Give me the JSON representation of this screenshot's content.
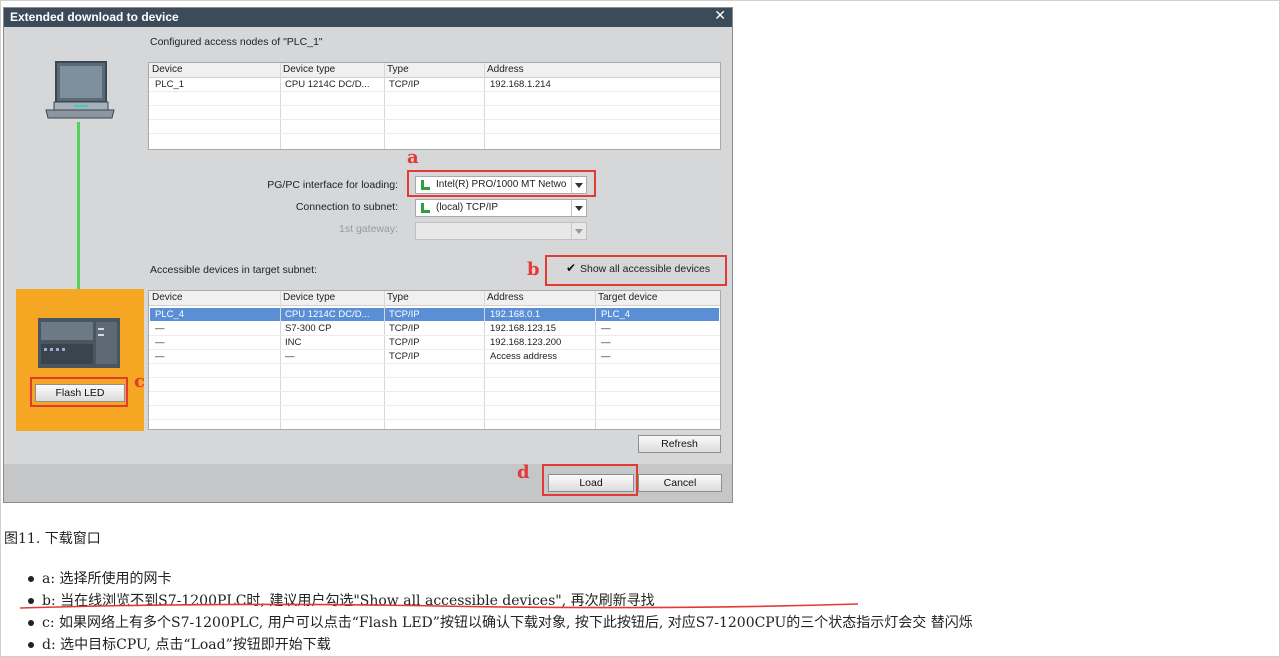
{
  "dialog": {
    "title": "Extended download to device",
    "close_glyph": "✕",
    "configured_nodes_label": "Configured access nodes of \"PLC_1\"",
    "configured_table": {
      "headers": [
        "Device",
        "Device type",
        "Type",
        "Address"
      ],
      "rows": [
        [
          "PLC_1",
          "CPU 1214C DC/D...",
          "TCP/IP",
          "192.168.1.214"
        ]
      ]
    },
    "pgpc_label": "PG/PC interface for loading:",
    "pgpc_value": "Intel(R) PRO/1000 MT Netwo",
    "subnet_label": "Connection to subnet:",
    "subnet_value": "(local) TCP/IP",
    "gateway_label": "1st gateway:",
    "gateway_value": "",
    "accessible_label": "Accessible devices in target subnet:",
    "show_all_label": "Show all accessible devices",
    "show_all_checked": true,
    "accessible_table": {
      "headers": [
        "Device",
        "Device type",
        "Type",
        "Address",
        "Target device"
      ],
      "rows": [
        [
          "PLC_4",
          "CPU 1214C DC/D...",
          "TCP/IP",
          "192.168.0.1",
          "PLC_4"
        ],
        [
          "—",
          "S7-300 CP",
          "TCP/IP",
          "192.168.123.15",
          "—"
        ],
        [
          "—",
          "INC",
          "TCP/IP",
          "192.168.123.200",
          "—"
        ],
        [
          "—",
          "—",
          "TCP/IP",
          "Access address",
          "—"
        ]
      ],
      "selected_row": 0
    },
    "flash_led_label": "Flash LED",
    "refresh_label": "Refresh",
    "load_label": "Load",
    "cancel_label": "Cancel"
  },
  "annotations": {
    "a": "a",
    "b": "b",
    "c": "c",
    "d": "d"
  },
  "caption": "图11. 下载窗口",
  "bullets": [
    "a: 选择所使用的网卡",
    "b: 当在线浏览不到S7-1200PLC时, 建议用户勾选\"Show all accessible devices\", 再次刷新寻找",
    "c: 如果网络上有多个S7-1200PLC, 用户可以点击“Flash LED”按钮以确认下载对象, 按下此按钮后, 对应S7-1200CPU的三个状态指示灯会交 替闪烁",
    "d: 选中目标CPU, 点击“Load”按钮即开始下载"
  ],
  "colors": {
    "titlebar": "#3c4b5a",
    "selection": "#5b8fd5",
    "annotation_red": "#e53935",
    "device_panel_orange": "#f5a623",
    "link_green": "#55d155"
  }
}
